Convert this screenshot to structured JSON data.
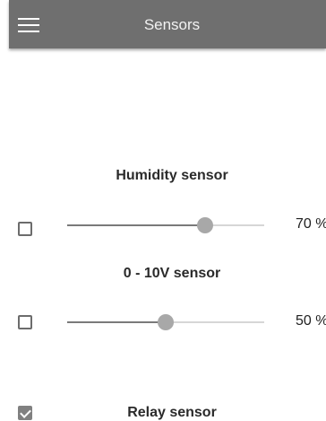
{
  "app_bar": {
    "title": "Sensors",
    "menu_icon": "hamburger-menu-icon"
  },
  "sensors": [
    {
      "title": "Humidity sensor",
      "checked": false,
      "value": 70,
      "value_label": "70 %"
    },
    {
      "title": "0 - 10V sensor",
      "checked": false,
      "value": 50,
      "value_label": "50 %"
    },
    {
      "title": "Relay sensor",
      "checked": true
    }
  ]
}
